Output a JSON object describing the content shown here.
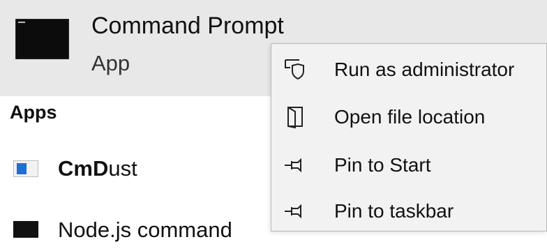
{
  "top_result": {
    "title": "Command Prompt",
    "subtitle": "App",
    "icon": "command-prompt-icon"
  },
  "apps_section": {
    "header": "Apps",
    "items": [
      {
        "label_bold": "CmD",
        "label_rest": "ust",
        "icon": "cmdust-app-icon"
      },
      {
        "label": "Node.js command",
        "icon": "nodejs-command-icon"
      }
    ]
  },
  "context_menu": {
    "items": [
      {
        "label": "Run as administrator",
        "icon": "shield-icon"
      },
      {
        "label": "Open file location",
        "icon": "folder-icon"
      },
      {
        "label": "Pin to Start",
        "icon": "pin-icon"
      },
      {
        "label": "Pin to taskbar",
        "icon": "pin-icon"
      }
    ]
  }
}
